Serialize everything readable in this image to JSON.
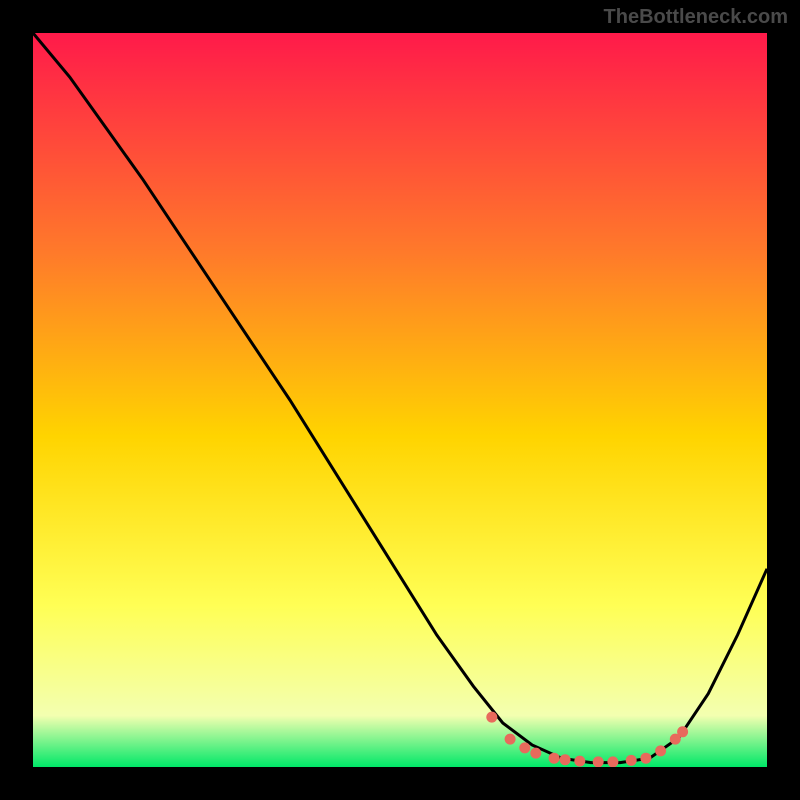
{
  "watermark": "TheBottleneck.com",
  "colors": {
    "background": "#000000",
    "gradient_top": "#ff1a4a",
    "gradient_mid1": "#ff7a2a",
    "gradient_mid2": "#ffd400",
    "gradient_mid3": "#ffff55",
    "gradient_mid4": "#f3ffb0",
    "gradient_bottom": "#00e868",
    "curve": "#000000",
    "dots": "#e86a5c"
  },
  "chart_data": {
    "type": "line",
    "title": "",
    "xlabel": "",
    "ylabel": "",
    "xlim": [
      0,
      100
    ],
    "ylim": [
      0,
      100
    ],
    "series": [
      {
        "name": "curve",
        "x": [
          0,
          5,
          10,
          15,
          20,
          25,
          30,
          35,
          40,
          45,
          50,
          55,
          60,
          64,
          68,
          72,
          76,
          80,
          84,
          88,
          92,
          96,
          100
        ],
        "y": [
          100,
          94,
          87,
          80,
          72.5,
          65,
          57.5,
          50,
          42,
          34,
          26,
          18,
          11,
          6,
          3,
          1.2,
          0.6,
          0.6,
          1.2,
          4,
          10,
          18,
          27
        ]
      }
    ],
    "dots": [
      {
        "x": 62.5,
        "y": 6.8
      },
      {
        "x": 65.0,
        "y": 3.8
      },
      {
        "x": 67.0,
        "y": 2.6
      },
      {
        "x": 68.5,
        "y": 1.9
      },
      {
        "x": 71.0,
        "y": 1.2
      },
      {
        "x": 72.5,
        "y": 1.0
      },
      {
        "x": 74.5,
        "y": 0.8
      },
      {
        "x": 77.0,
        "y": 0.7
      },
      {
        "x": 79.0,
        "y": 0.7
      },
      {
        "x": 81.5,
        "y": 0.9
      },
      {
        "x": 83.5,
        "y": 1.2
      },
      {
        "x": 85.5,
        "y": 2.2
      },
      {
        "x": 87.5,
        "y": 3.8
      },
      {
        "x": 88.5,
        "y": 4.8
      }
    ]
  }
}
